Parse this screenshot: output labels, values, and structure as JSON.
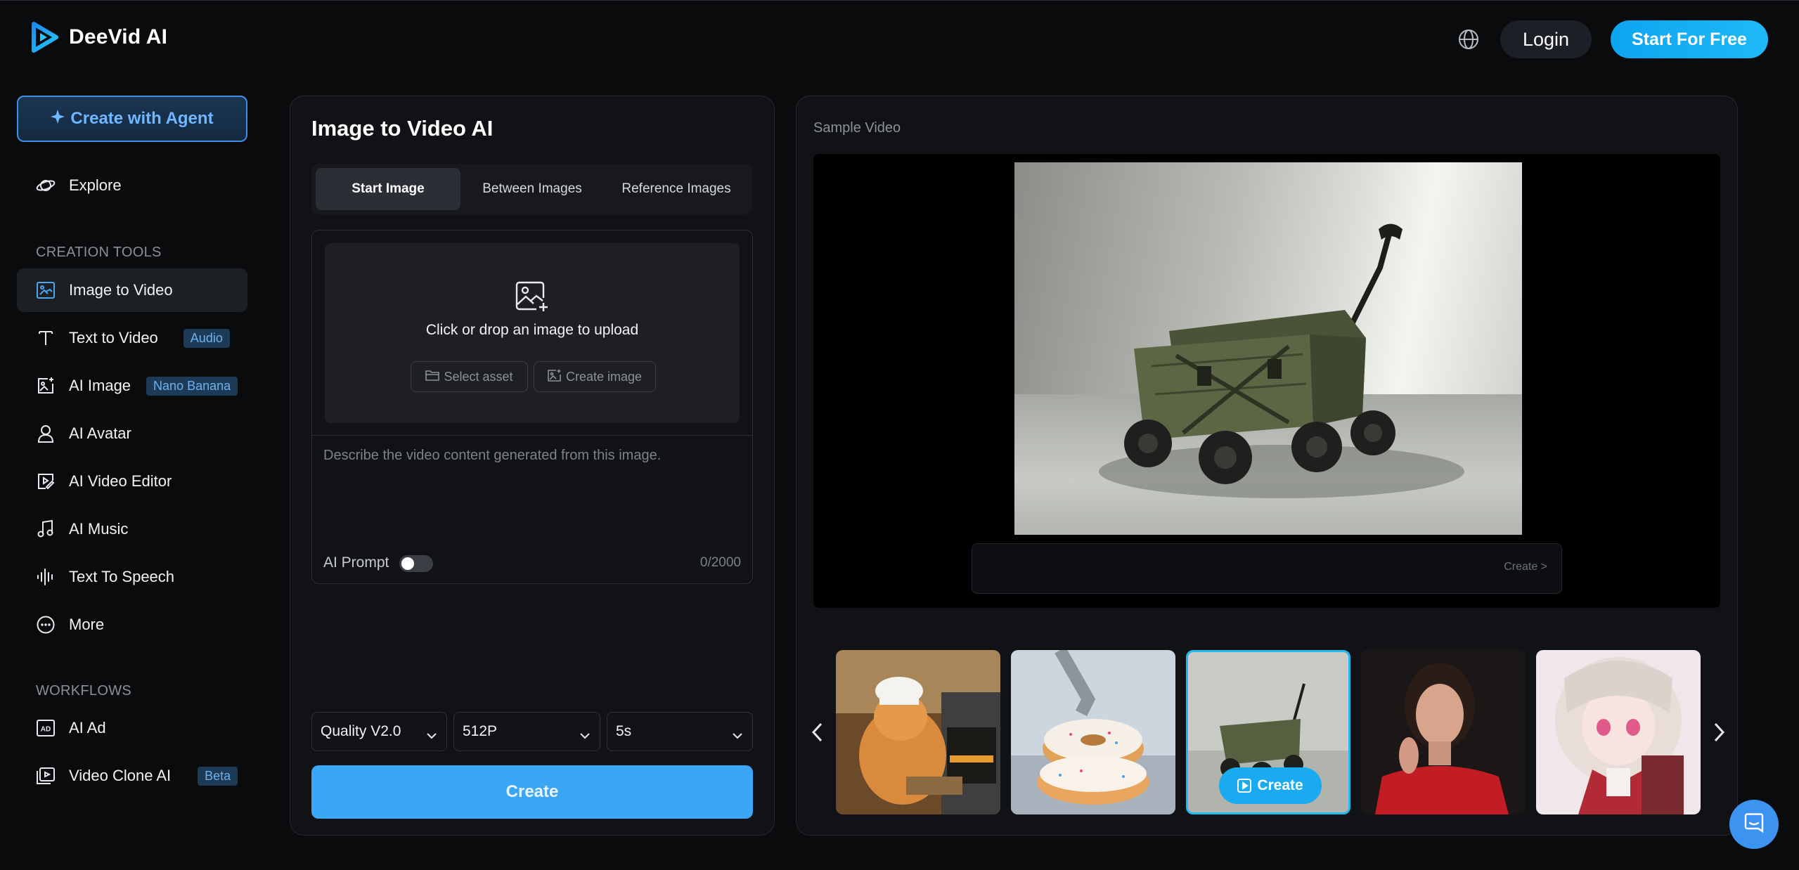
{
  "header": {
    "brand": "DeeVid AI",
    "login_label": "Login",
    "start_label": "Start For Free"
  },
  "sidebar": {
    "agent_label": "Create with Agent",
    "explore_label": "Explore",
    "creation_tools_label": "CREATION TOOLS",
    "items": [
      {
        "label": "Image to Video",
        "badge": ""
      },
      {
        "label": "Text to Video",
        "badge": "Audio"
      },
      {
        "label": "AI Image",
        "badge": "Nano Banana"
      },
      {
        "label": "AI Avatar",
        "badge": ""
      },
      {
        "label": "AI Video Editor",
        "badge": ""
      },
      {
        "label": "AI Music",
        "badge": ""
      },
      {
        "label": "Text To Speech",
        "badge": ""
      },
      {
        "label": "More",
        "badge": ""
      }
    ],
    "workflows_label": "WORKFLOWS",
    "workflows": [
      {
        "label": "AI Ad",
        "badge": ""
      },
      {
        "label": "Video Clone AI",
        "badge": "Beta"
      }
    ]
  },
  "editor": {
    "title": "Image to Video AI",
    "tabs": [
      "Start Image",
      "Between Images",
      "Reference Images"
    ],
    "active_tab": "Start Image",
    "upload_text": "Click or drop an image to upload",
    "select_asset_label": "Select asset",
    "create_image_label": "Create image",
    "prompt_placeholder": "Describe the video content generated from this image.",
    "ai_prompt_label": "AI Prompt",
    "ai_prompt_enabled": false,
    "char_count": "0/2000",
    "quality": "Quality V2.0",
    "resolution": "512P",
    "duration": "5s",
    "create_label": "Create"
  },
  "preview": {
    "sample_label": "Sample Video",
    "caption_create": "Create >",
    "thumb_create_label": "Create",
    "selected_thumb": 3
  },
  "colors": {
    "accent": "#1fb8f7",
    "create_button": "#3ba6f5",
    "badge_bg": "#1d3a57",
    "background": "#0a0b0d"
  }
}
